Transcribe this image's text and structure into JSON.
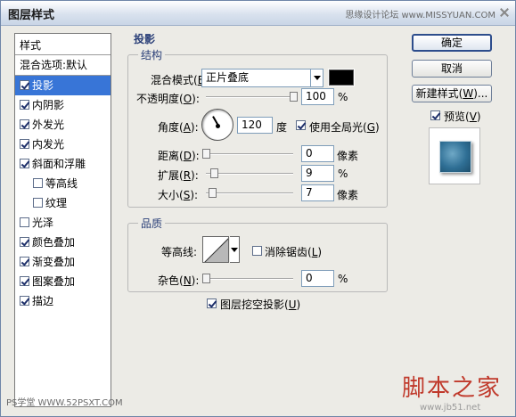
{
  "window": {
    "title": "图层样式",
    "watermark_top": "思缘设计论坛 www.MISSYUAN.COM"
  },
  "sidebar": {
    "header": "样式",
    "blend_item": "混合选项:默认",
    "items": [
      {
        "label": "投影",
        "checked": true,
        "selected": true,
        "indent": false
      },
      {
        "label": "内阴影",
        "checked": true,
        "indent": false
      },
      {
        "label": "外发光",
        "checked": true,
        "indent": false
      },
      {
        "label": "内发光",
        "checked": true,
        "indent": false
      },
      {
        "label": "斜面和浮雕",
        "checked": true,
        "indent": false
      },
      {
        "label": "等高线",
        "checked": false,
        "indent": true
      },
      {
        "label": "纹理",
        "checked": false,
        "indent": true
      },
      {
        "label": "光泽",
        "checked": false,
        "indent": false
      },
      {
        "label": "颜色叠加",
        "checked": true,
        "indent": false
      },
      {
        "label": "渐变叠加",
        "checked": true,
        "indent": false
      },
      {
        "label": "图案叠加",
        "checked": true,
        "indent": false
      },
      {
        "label": "描边",
        "checked": true,
        "indent": false
      }
    ]
  },
  "panel": {
    "title": "投影",
    "structure": {
      "title": "结构",
      "blend_mode_label": "混合模式(",
      "blend_mode_key": "E",
      "blend_mode_value": "正片叠底",
      "blend_color": "#000000",
      "opacity_label": "不透明度(",
      "opacity_key": "O",
      "opacity_value": "100",
      "opacity_unit": "%",
      "opacity_level": 1.0,
      "angle_label": "角度(",
      "angle_key": "A",
      "angle_value": "120",
      "angle_unit": "度",
      "global_light_label": "使用全局光(",
      "global_light_key": "G",
      "global_light_checked": true,
      "distance_label": "距离(",
      "distance_key": "D",
      "distance_value": "0",
      "distance_unit": "像素",
      "spread_label": "扩展(",
      "spread_key": "R",
      "spread_value": "9",
      "spread_unit": "%",
      "size_label": "大小(",
      "size_key": "S",
      "size_value": "7",
      "size_unit": "像素"
    },
    "quality": {
      "title": "品质",
      "contour_label": "等高线:",
      "antialias_label": "消除锯齿(",
      "antialias_key": "L",
      "antialias_checked": false,
      "noise_label": "杂色(",
      "noise_key": "N",
      "noise_value": "0",
      "noise_unit": "%"
    },
    "knockout_label": "图层挖空投影(",
    "knockout_key": "U",
    "knockout_checked": true
  },
  "buttons": {
    "ok": "确定",
    "cancel": "取消",
    "new_style": "新建样式(",
    "new_style_key": "W",
    "new_style_suffix": ")...",
    "preview_label": "预览(",
    "preview_key": "V",
    "preview_checked": true
  },
  "footer": {
    "left": "PS学堂 WWW.52PSXT.COM",
    "right": "脚本之家",
    "url": "www.jb51.net"
  }
}
